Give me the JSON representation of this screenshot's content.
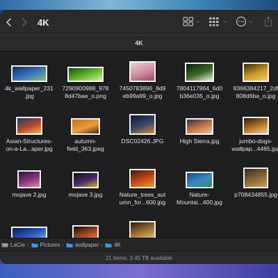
{
  "toolbar": {
    "back_label": "‹",
    "forward_label": "›",
    "folder_title": "4K"
  },
  "tab": {
    "label": "4K"
  },
  "files": [
    {
      "name": "4k_wallpaper_231\n.jpg",
      "colors": [
        "#0d2e5c",
        "#3a78c0",
        "#8fbf6a"
      ]
    },
    {
      "name": "7290900988_978\n8d47bae_o.png",
      "colors": [
        "#1b4a10",
        "#6ab832",
        "#d8ec9a"
      ]
    },
    {
      "name": "7450783896_8d9\neb99a99_o.jpg",
      "colors": [
        "#e8d6d6",
        "#d28aa0",
        "#9a4a62"
      ]
    },
    {
      "name": "7804117964_6d0\nb36e035_o.jpg",
      "colors": [
        "#0e1a0e",
        "#3e6a2a",
        "#e8f0e0"
      ]
    },
    {
      "name": "8366384217_2df\n808d6ba_o.jpg",
      "colors": [
        "#3a2a08",
        "#c89a2a",
        "#f0d060"
      ]
    },
    {
      "name": "Asian-Structures-\non-a-La...aper.jpg",
      "colors": [
        "#1a3a6a",
        "#b84a2a",
        "#e8b060"
      ]
    },
    {
      "name": "autumn-\nfield_363.jpeg",
      "colors": [
        "#c86a20",
        "#e8a040",
        "#4a2a10"
      ]
    },
    {
      "name": "DSC02426.JPG",
      "colors": [
        "#101830",
        "#3a4a6a",
        "#d88a3a"
      ]
    },
    {
      "name": "High Sierra.jpg",
      "colors": [
        "#3a2a4a",
        "#c87a4a",
        "#e8c0a0"
      ]
    },
    {
      "name": "jumbo-dogs-\nwallpap...4465.jpg",
      "colors": [
        "#2a1a10",
        "#b8782a",
        "#e8d0a0"
      ]
    },
    {
      "name": "mojave 2.jpg",
      "colors": [
        "#2a103a",
        "#8a3a7a",
        "#d88ab0"
      ]
    },
    {
      "name": "mojave 3.jpg",
      "colors": [
        "#101010",
        "#4a2a6a",
        "#c8b040"
      ]
    },
    {
      "name": "Nature_trees_aut\numn_for...600.jpg",
      "colors": [
        "#3a1a08",
        "#c84a18",
        "#e89a30"
      ]
    },
    {
      "name": "Nature-\nMountai...400.jpg",
      "colors": [
        "#1a4a8a",
        "#3a8ac0",
        "#2a8a6a"
      ]
    },
    {
      "name": "p708434855.jpg",
      "colors": [
        "#3a2a1a",
        "#8a6a3a",
        "#c8a060"
      ]
    },
    {
      "name": "",
      "colors": [
        "#0a1a4a",
        "#2a5ac0",
        "#8ab0e8"
      ]
    },
    {
      "name": "",
      "colors": [
        "#1a0a0a",
        "#a84a2a",
        "#e8803a"
      ]
    },
    {
      "name": "",
      "colors": [
        "#2a1a0a",
        "#a87a3a",
        "#e8c890"
      ]
    }
  ],
  "pathbar": {
    "items": [
      "LaCie",
      "Pictures",
      "wallpaper",
      "4K"
    ]
  },
  "status": {
    "text": "21 items, 3.45 TB available"
  },
  "accent": "#4a90e2"
}
